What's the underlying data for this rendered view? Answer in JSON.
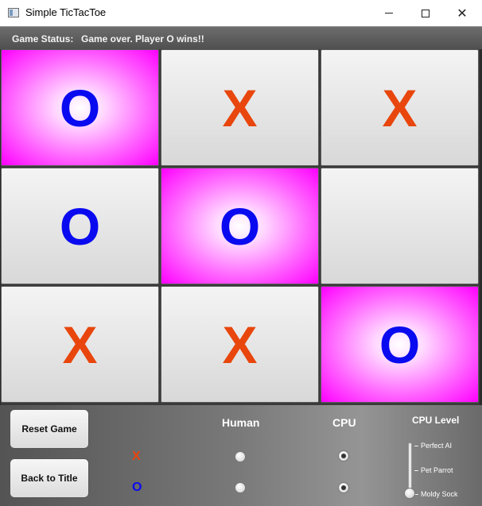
{
  "window": {
    "title": "Simple TicTacToe",
    "minimize": "—",
    "maximize": "□",
    "close": "✕"
  },
  "status": {
    "label": "Game Status:",
    "value": "Game over. Player O wins!!"
  },
  "board": {
    "cells": [
      "O",
      "X",
      "X",
      "O",
      "O",
      "",
      "X",
      "X",
      "O"
    ],
    "winning_cells": [
      0,
      4,
      8
    ],
    "colors": {
      "x": "#e8460d",
      "o": "#0a0af0",
      "win_highlight": "#ff00ff"
    }
  },
  "controls": {
    "reset_label": "Reset Game",
    "back_label": "Back to Title",
    "human_header": "Human",
    "cpu_header": "CPU",
    "level_header": "CPU Level",
    "players": [
      {
        "label": "X",
        "selected": "CPU"
      },
      {
        "label": "O",
        "selected": "CPU"
      }
    ],
    "levels": [
      "Perfect AI",
      "Pet Parrot",
      "Moldy Sock"
    ],
    "selected_level": "Moldy Sock"
  }
}
